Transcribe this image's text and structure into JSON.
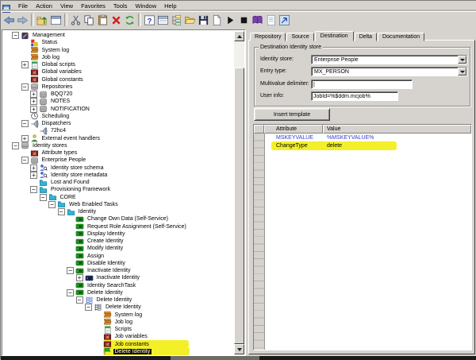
{
  "window": {
    "app_icon": "console-icon"
  },
  "menu": {
    "items": [
      "File",
      "Action",
      "View",
      "Favorites",
      "Tools",
      "Window",
      "Help"
    ]
  },
  "toolbar": {
    "buttons": [
      {
        "name": "back"
      },
      {
        "name": "forward"
      },
      {
        "name": "sep"
      },
      {
        "name": "up-level"
      },
      {
        "name": "properties"
      },
      {
        "name": "sep"
      },
      {
        "name": "cut"
      },
      {
        "name": "copy"
      },
      {
        "name": "paste"
      },
      {
        "name": "delete"
      },
      {
        "name": "refresh"
      },
      {
        "name": "sep"
      },
      {
        "name": "help"
      },
      {
        "name": "properties2"
      },
      {
        "name": "export-tree"
      },
      {
        "name": "open-folder"
      },
      {
        "name": "save"
      },
      {
        "name": "new-doc"
      },
      {
        "name": "run"
      },
      {
        "name": "stop"
      },
      {
        "name": "book"
      },
      {
        "name": "notes"
      },
      {
        "name": "exit"
      }
    ]
  },
  "tree": {
    "rows": [
      {
        "depth": 0,
        "toggle": "minus",
        "icon": "management",
        "label": "Management"
      },
      {
        "depth": 1,
        "toggle": null,
        "icon": "status",
        "label": "Status"
      },
      {
        "depth": 1,
        "toggle": null,
        "icon": "log",
        "label": "System log"
      },
      {
        "depth": 1,
        "toggle": null,
        "icon": "log",
        "label": "Job log"
      },
      {
        "depth": 1,
        "toggle": "plus",
        "icon": "script",
        "label": "Global scripts"
      },
      {
        "depth": 1,
        "toggle": null,
        "icon": "idi",
        "label": "Global variables"
      },
      {
        "depth": 1,
        "toggle": null,
        "icon": "idi",
        "label": "Global constants"
      },
      {
        "depth": 1,
        "toggle": "minus",
        "icon": "repo",
        "label": "Repositories"
      },
      {
        "depth": 2,
        "toggle": "plus",
        "icon": "db",
        "label": "BQQ720"
      },
      {
        "depth": 2,
        "toggle": "plus",
        "icon": "db",
        "label": "NOTES"
      },
      {
        "depth": 2,
        "toggle": "plus",
        "icon": "db",
        "label": "NOTIFICATION"
      },
      {
        "depth": 1,
        "toggle": null,
        "icon": "clock",
        "label": "Scheduling"
      },
      {
        "depth": 1,
        "toggle": "minus",
        "icon": "dispatcher",
        "label": "Dispatchers"
      },
      {
        "depth": 2,
        "toggle": null,
        "icon": "dispatcher",
        "label": "72hc4"
      },
      {
        "depth": 1,
        "toggle": "plus",
        "icon": "person",
        "label": "External event handlers"
      },
      {
        "depth": 0,
        "toggle": "minus",
        "icon": "repo",
        "label": "Identity stores"
      },
      {
        "depth": 1,
        "toggle": null,
        "icon": "idi",
        "label": "Attribute types"
      },
      {
        "depth": 1,
        "toggle": "minus",
        "icon": "db",
        "label": "Enterprise People"
      },
      {
        "depth": 2,
        "toggle": "plus",
        "icon": "schema",
        "label": "Identity store schema"
      },
      {
        "depth": 2,
        "toggle": "plus",
        "icon": "schema",
        "label": "Identity store metadata"
      },
      {
        "depth": 2,
        "toggle": null,
        "icon": "folder",
        "label": "Lost and Found"
      },
      {
        "depth": 2,
        "toggle": "minus",
        "icon": "folder",
        "label": "Provisioning Framework"
      },
      {
        "depth": 3,
        "toggle": "minus",
        "icon": "folder",
        "label": "CORE"
      },
      {
        "depth": 4,
        "toggle": "minus",
        "icon": "folder",
        "label": "Web Enabled Tasks"
      },
      {
        "depth": 5,
        "toggle": "minus",
        "icon": "folder",
        "label": "Identity"
      },
      {
        "depth": 6,
        "toggle": null,
        "icon": "task",
        "label": "Change Own Data (Self-Service)"
      },
      {
        "depth": 6,
        "toggle": null,
        "icon": "task",
        "label": "Request Role Assignment (Self-Service)"
      },
      {
        "depth": 6,
        "toggle": null,
        "icon": "task",
        "label": "Display Identity"
      },
      {
        "depth": 6,
        "toggle": null,
        "icon": "task",
        "label": "Create Identity"
      },
      {
        "depth": 6,
        "toggle": null,
        "icon": "task",
        "label": "Modify Identity"
      },
      {
        "depth": 6,
        "toggle": null,
        "icon": "task",
        "label": "Assign"
      },
      {
        "depth": 6,
        "toggle": null,
        "icon": "task",
        "label": "Disable Identity"
      },
      {
        "depth": 6,
        "toggle": "minus",
        "icon": "task",
        "label": "Inactivate Identity"
      },
      {
        "depth": 7,
        "toggle": "plus",
        "icon": "taskdark",
        "label": "Inactivate Identity"
      },
      {
        "depth": 6,
        "toggle": null,
        "icon": "task",
        "label": "Identity SearchTask"
      },
      {
        "depth": 6,
        "toggle": "minus",
        "icon": "task",
        "label": "Delete Identity"
      },
      {
        "depth": 7,
        "toggle": "minus",
        "icon": "flowchart",
        "label": "Delete Identity"
      },
      {
        "depth": 8,
        "toggle": "minus",
        "icon": "jobtree",
        "label": "Delete Identity"
      },
      {
        "depth": 9,
        "toggle": null,
        "icon": "log",
        "label": "System log"
      },
      {
        "depth": 9,
        "toggle": null,
        "icon": "log",
        "label": "Job log"
      },
      {
        "depth": 9,
        "toggle": null,
        "icon": "script",
        "label": "Scripts"
      },
      {
        "depth": 9,
        "toggle": null,
        "icon": "idi",
        "label": "Job variables"
      },
      {
        "depth": 9,
        "toggle": null,
        "icon": "idi",
        "label": "Job constants",
        "highlight": true
      },
      {
        "depth": 9,
        "toggle": null,
        "icon": "runpass",
        "label": "Delete Identity",
        "highlight": true,
        "selected": true
      }
    ]
  },
  "right_panel": {
    "tabs": [
      "Repository",
      "Source",
      "Destination",
      "Delta",
      "Documentation"
    ],
    "active_tab": "Destination",
    "form": {
      "group_title": "Destination Identity store",
      "fields": [
        {
          "label": "Identity store:",
          "value": "Enterprise People",
          "type": "combo"
        },
        {
          "label": "Entry type:",
          "value": "MX_PERSON",
          "type": "combo"
        },
        {
          "label": "Multivalue delimiter:",
          "value": "|",
          "type": "text"
        },
        {
          "label": "User info:",
          "value": "JobId=%$ddm.mcjob%",
          "type": "text"
        }
      ],
      "insert_button": "Insert template"
    },
    "grid": {
      "columns": [
        "Attribute",
        "Value"
      ],
      "rows": [
        {
          "attribute": "MSKEYVALUE",
          "value": "%MSKEYVALUE%",
          "color": "blue"
        },
        {
          "attribute": "ChangeType",
          "value": "delete",
          "highlight": true
        }
      ]
    }
  },
  "colors": {
    "highlight_yellow": "#f3ef29",
    "grid_link_blue": "#3a3ac8",
    "selection_black": "#141414",
    "window_gray": "#d6d3ce"
  }
}
